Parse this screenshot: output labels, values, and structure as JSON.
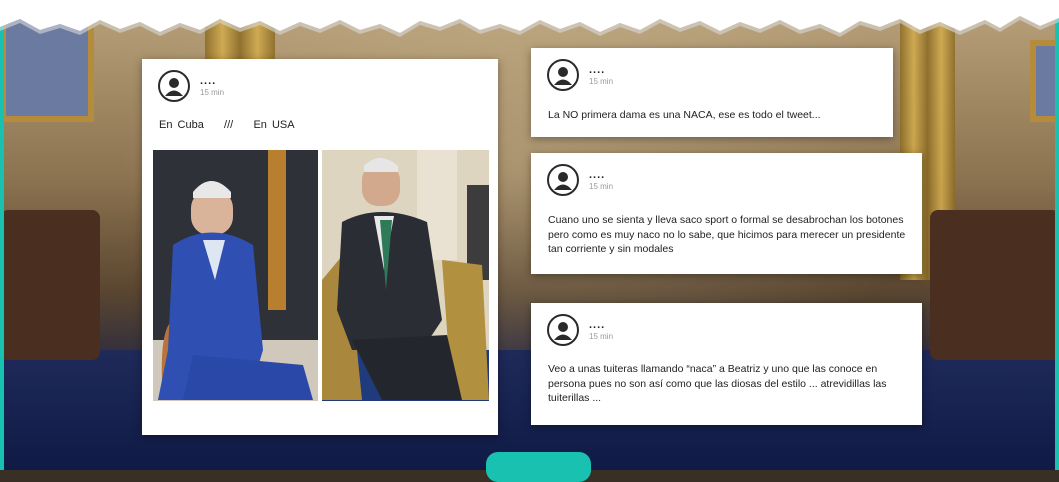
{
  "palette": {
    "accent": "#19c2b0",
    "card_bg": "#ffffff",
    "text": "#222222",
    "meta": "#999999"
  },
  "icons": {
    "avatar": "user-circle-icon"
  },
  "posts": [
    {
      "user": "....",
      "time": "15 min",
      "captions": [
        "En Cuba",
        "///",
        "En USA"
      ],
      "images": [
        "photo-en-cuba",
        "photo-en-usa"
      ]
    },
    {
      "user": "....",
      "time": "15 min",
      "text": "La NO primera dama es una NACA, ese es todo el tweet..."
    },
    {
      "user": "....",
      "time": "15 min",
      "text": "Cuano uno se sienta y lleva saco sport o formal se desabrochan los botones pero como es muy naco no lo sabe, que hicimos para merecer un presidente tan corriente y sin modales"
    },
    {
      "user": "....",
      "time": "15 min",
      "text": "Veo a unas tuiteras llamando “naca” a Beatriz y uno que las conoce en persona pues no son así como que las diosas del estilo ... atrevidillas las tuiterillas ..."
    }
  ]
}
